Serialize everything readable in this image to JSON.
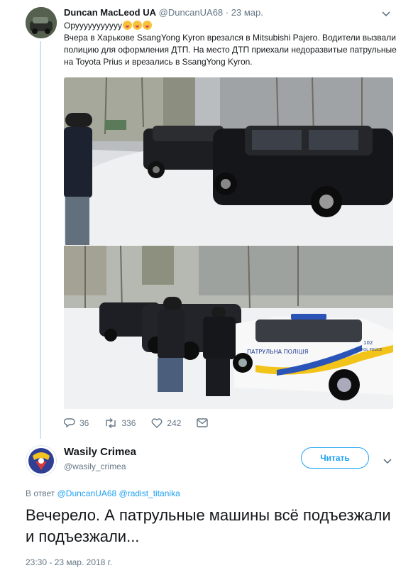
{
  "tweet1": {
    "author_name": "Duncan MacLeod UA",
    "handle": "@DuncanUA68",
    "date": "23 мар.",
    "line1": "Орууууууууууу",
    "body": "Вчера в Харькове SsangYong Kyron врезался в Mitsubishi Pajero. Водители вызвали полицию для оформления ДТП. На место ДТП приехали недоразвитые патрульные на Toyota Prius и врезались в SsangYong Kyron.",
    "police_car_label": "ПАТРУЛЬНА ПОЛІЦІЯ",
    "police_car_number": "102",
    "police_car_patrol": "PATROL POLICE",
    "stats": {
      "replies": "36",
      "retweets": "336",
      "likes": "242"
    }
  },
  "tweet2": {
    "author_name": "Wasily Crimea",
    "handle": "@wasily_crimea",
    "follow_label": "Читать",
    "reply_prefix": "В ответ",
    "reply_handle1": "@DuncanUA68",
    "reply_handle2": "@radist_titanika",
    "body": "Вечерело. А патрульные машины всё подъезжали и подъезжали...",
    "timestamp": "23:30 - 23 мар. 2018 г."
  },
  "colors": {
    "accent": "#1da1f2",
    "muted": "#657786",
    "text": "#14171a",
    "thread": "#c4e6f7"
  },
  "icons": [
    "chevron-down-icon",
    "reply-icon",
    "retweet-icon",
    "heart-icon",
    "dm-icon",
    "emoji-icon"
  ]
}
